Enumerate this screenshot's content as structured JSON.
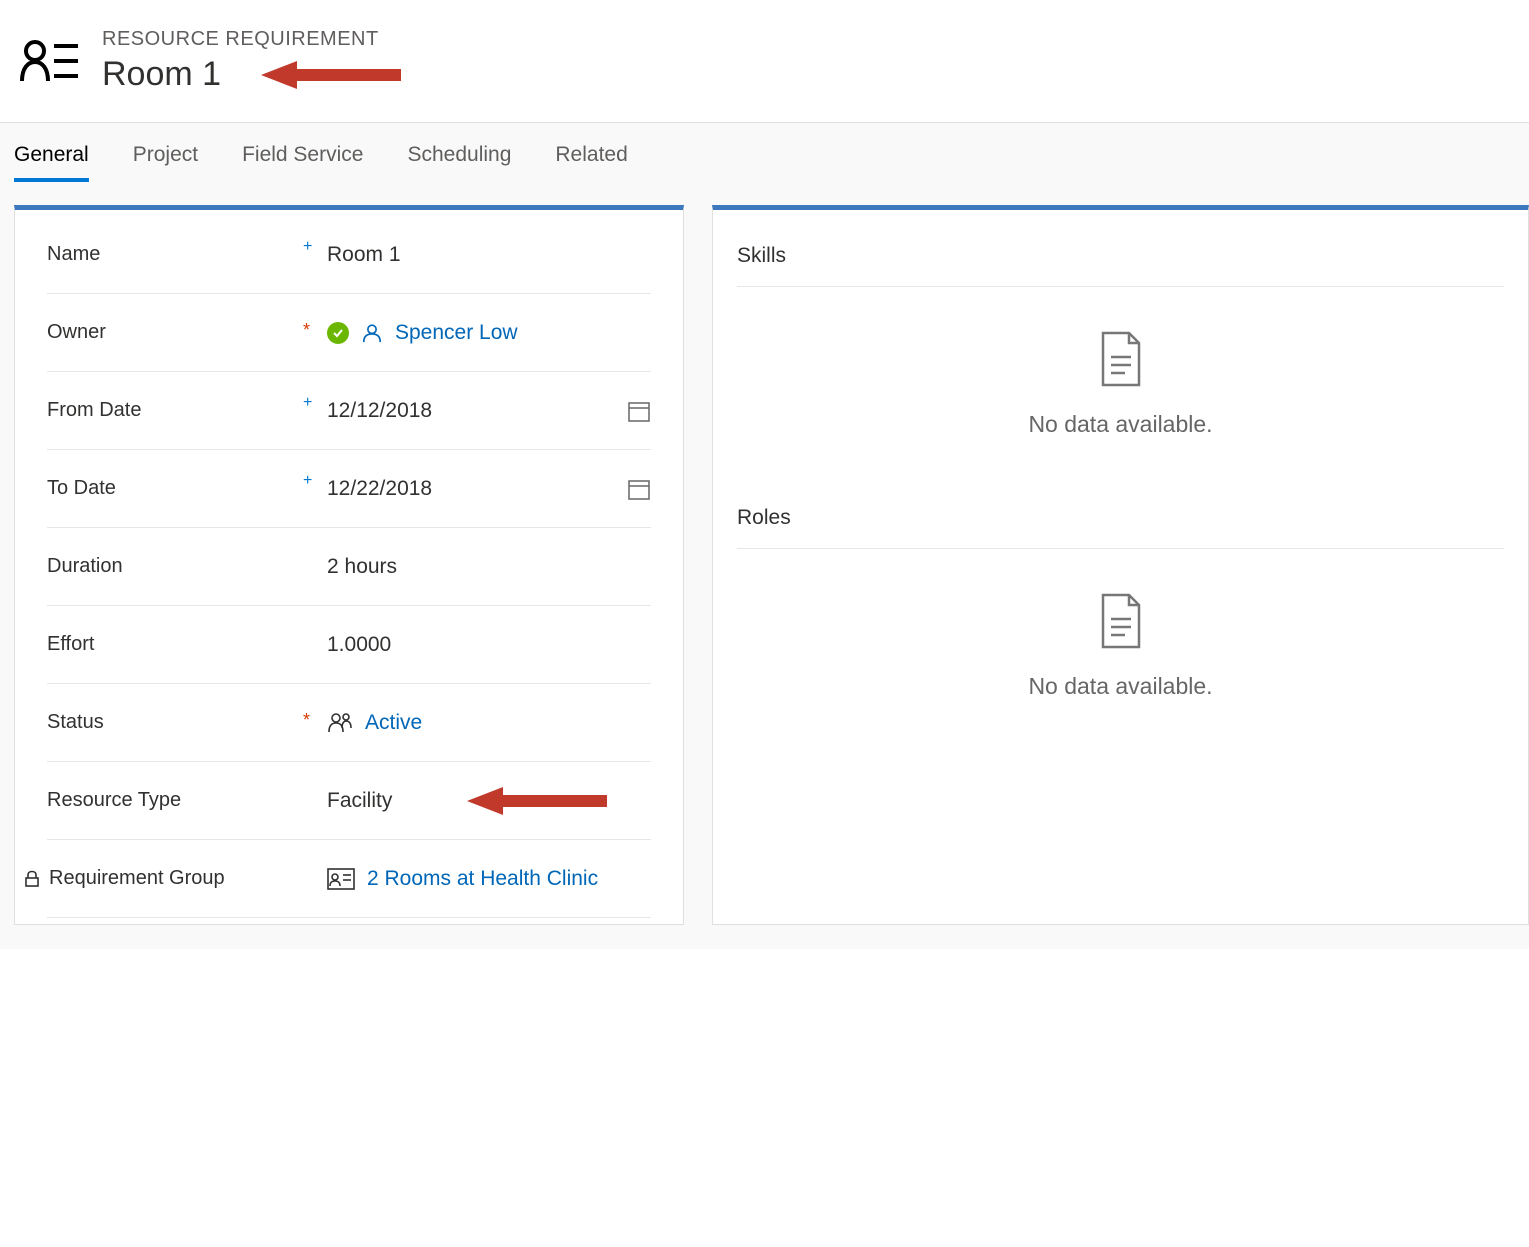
{
  "header": {
    "eyebrow": "RESOURCE REQUIREMENT",
    "title": "Room 1"
  },
  "tabs": [
    "General",
    "Project",
    "Field Service",
    "Scheduling",
    "Related"
  ],
  "activeTab": "General",
  "form": {
    "name": {
      "label": "Name",
      "value": "Room 1"
    },
    "owner": {
      "label": "Owner",
      "value": "Spencer Low"
    },
    "fromDate": {
      "label": "From Date",
      "value": "12/12/2018"
    },
    "toDate": {
      "label": "To Date",
      "value": "12/22/2018"
    },
    "duration": {
      "label": "Duration",
      "value": "2 hours"
    },
    "effort": {
      "label": "Effort",
      "value": "1.0000"
    },
    "status": {
      "label": "Status",
      "value": "Active"
    },
    "resourceType": {
      "label": "Resource Type",
      "value": "Facility"
    },
    "requirementGroup": {
      "label": "Requirement Group",
      "value": "2 Rooms at Health Clinic"
    }
  },
  "sections": {
    "skills": {
      "title": "Skills",
      "empty": "No data available."
    },
    "roles": {
      "title": "Roles",
      "empty": "No data available."
    }
  }
}
